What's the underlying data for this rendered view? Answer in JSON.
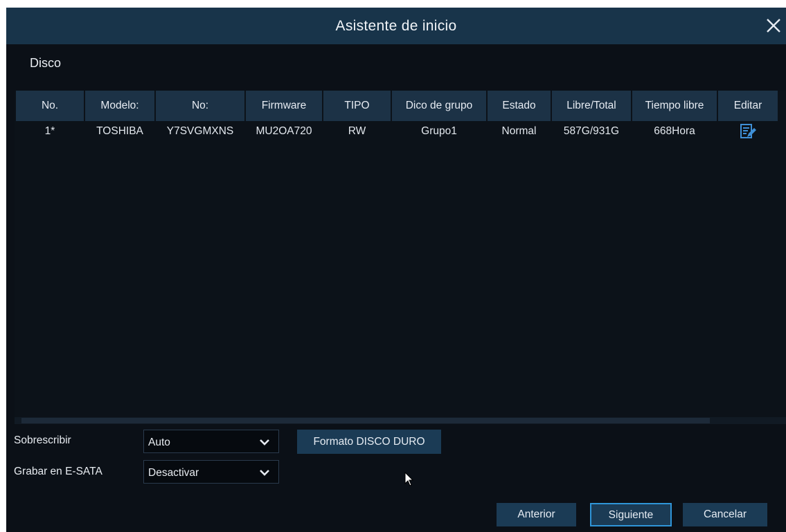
{
  "window": {
    "title": "Asistente de inicio",
    "close_icon": "close-icon"
  },
  "section": {
    "title": "Disco"
  },
  "table": {
    "columns": [
      "No.",
      "Modelo:",
      "No:",
      "Firmware",
      "TIPO",
      "Dico de grupo",
      "Estado",
      "Libre/Total",
      "Tiempo libre",
      "Editar"
    ],
    "rows": [
      {
        "no": "1*",
        "model": "TOSHIBA",
        "serial": "Y7SVGMXNS",
        "firmware": "MU2OA720",
        "type": "RW",
        "group": "Grupo1",
        "status": "Normal",
        "free_total": "587G/931G",
        "free_time": "668Hora",
        "edit_icon": "edit-icon"
      }
    ]
  },
  "settings": {
    "overwrite": {
      "label": "Sobrescribir",
      "value": "Auto"
    },
    "esata": {
      "label": "Grabar en E-SATA",
      "value": "Desactivar"
    },
    "format_button": "Formato DISCO DURO"
  },
  "footer": {
    "prev_label": "Anterior",
    "next_label": "Siguiente",
    "cancel_label": "Cancelar"
  },
  "colors": {
    "background": "#0b1017",
    "titlebar": "#18344a",
    "header_cell": "#1c3246",
    "button": "#1b3b55",
    "focus_border": "#2f95d8",
    "edit_icon": "#3f8fd6"
  }
}
